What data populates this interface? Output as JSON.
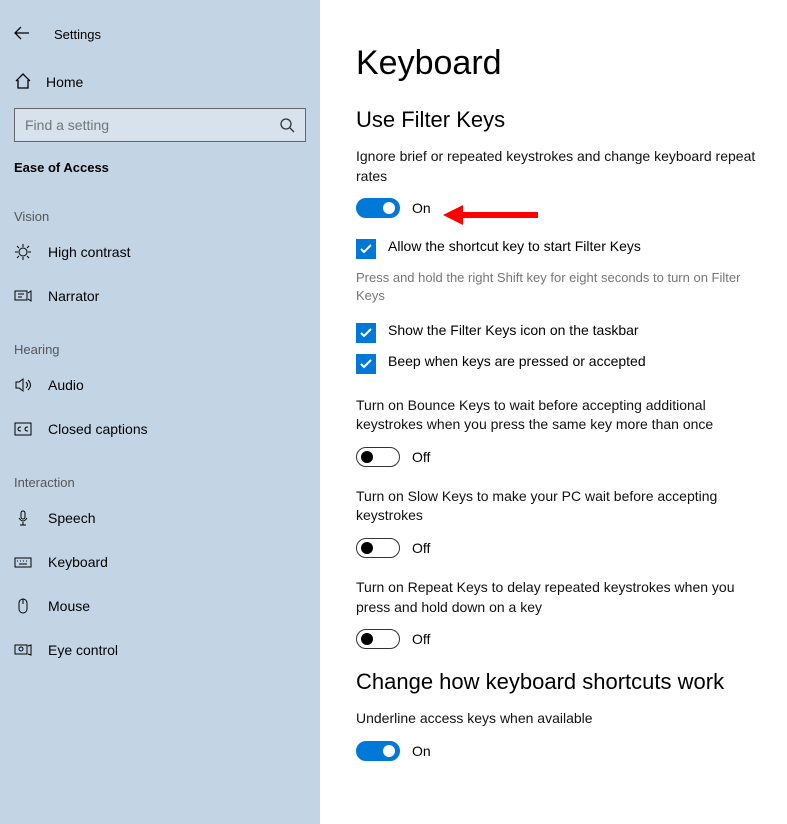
{
  "window": {
    "title": "Settings"
  },
  "sidebar": {
    "home": "Home",
    "search_placeholder": "Find a setting",
    "category": "Ease of Access",
    "groups": [
      {
        "label": "Vision",
        "items": [
          {
            "id": "high-contrast",
            "label": "High contrast"
          },
          {
            "id": "narrator",
            "label": "Narrator"
          }
        ]
      },
      {
        "label": "Hearing",
        "items": [
          {
            "id": "audio",
            "label": "Audio"
          },
          {
            "id": "closed-captions",
            "label": "Closed captions"
          }
        ]
      },
      {
        "label": "Interaction",
        "items": [
          {
            "id": "speech",
            "label": "Speech"
          },
          {
            "id": "keyboard",
            "label": "Keyboard"
          },
          {
            "id": "mouse",
            "label": "Mouse"
          },
          {
            "id": "eye-control",
            "label": "Eye control"
          }
        ]
      }
    ]
  },
  "page": {
    "title": "Keyboard",
    "section1": {
      "heading": "Use Filter Keys",
      "desc": "Ignore brief or repeated keystrokes and change keyboard repeat rates",
      "toggle_state": "On",
      "checks": [
        {
          "id": "allow-shortcut",
          "label": "Allow the shortcut key to start Filter Keys",
          "hint": "Press and hold the right Shift key for eight seconds to turn on Filter Keys"
        },
        {
          "id": "taskbar-icon",
          "label": "Show the Filter Keys icon on the taskbar"
        },
        {
          "id": "beep",
          "label": "Beep when keys are pressed or accepted"
        }
      ],
      "subtoggles": [
        {
          "id": "bounce-keys",
          "desc": "Turn on Bounce Keys to wait before accepting additional keystrokes when you press the same key more than once",
          "state": "Off"
        },
        {
          "id": "slow-keys",
          "desc": "Turn on Slow Keys to make your PC wait before accepting keystrokes",
          "state": "Off"
        },
        {
          "id": "repeat-keys",
          "desc": "Turn on Repeat Keys to delay repeated keystrokes when you press and hold down on a key",
          "state": "Off"
        }
      ]
    },
    "section2": {
      "heading": "Change how keyboard shortcuts work",
      "underline": {
        "desc": "Underline access keys when available",
        "state": "On"
      }
    }
  }
}
